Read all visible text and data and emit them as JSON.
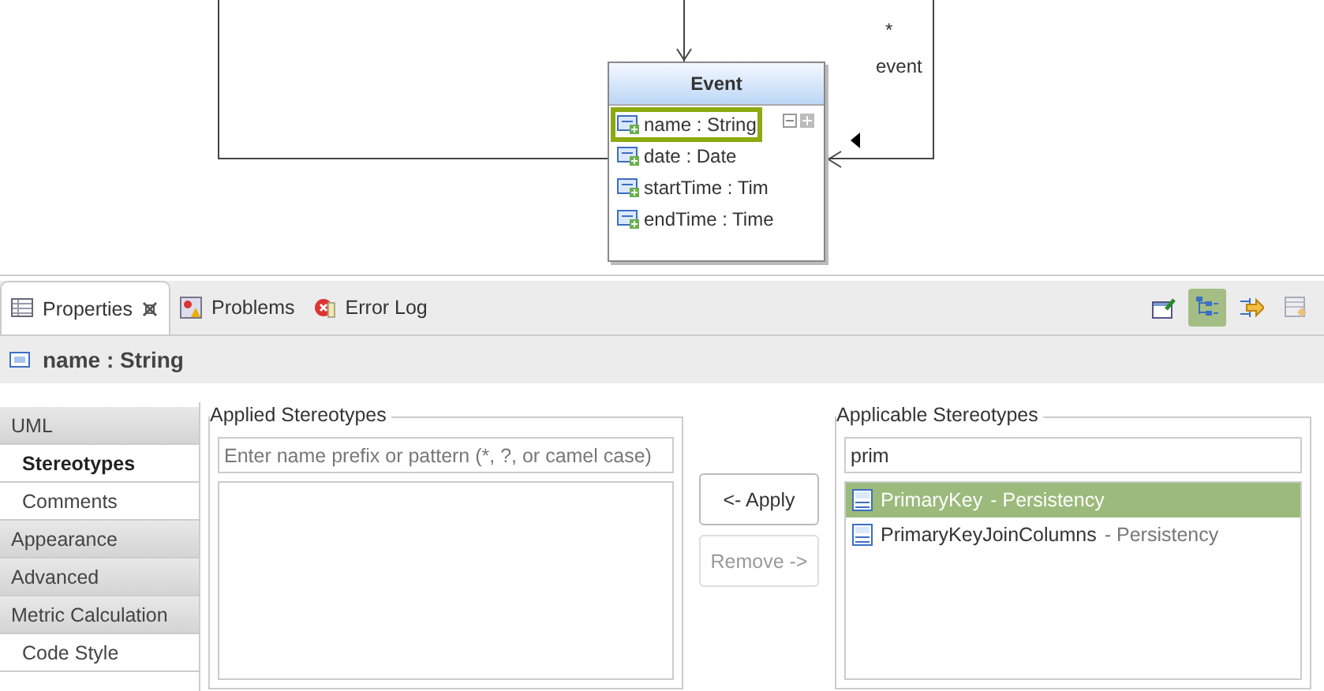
{
  "diagram": {
    "class": {
      "name": "Event",
      "attributes": [
        {
          "label": "name : String",
          "selected": true
        },
        {
          "label": "date : Date",
          "selected": false
        },
        {
          "label": "startTime : Tim",
          "selected": false
        },
        {
          "label": "endTime : Time",
          "selected": false
        }
      ]
    },
    "association": {
      "multiplicity": "*",
      "role": "event"
    }
  },
  "tabs": [
    {
      "label": "Properties",
      "closable": true,
      "selected": true
    },
    {
      "label": "Problems",
      "closable": false,
      "selected": false
    },
    {
      "label": "Error Log",
      "closable": false,
      "selected": false
    }
  ],
  "toolbar": [
    {
      "selected": false
    },
    {
      "selected": true
    },
    {
      "selected": false
    },
    {
      "selected": false
    }
  ],
  "title": "name : String",
  "sidebar": {
    "items": [
      {
        "label": "UML",
        "kind": "section",
        "selected": false
      },
      {
        "label": "Stereotypes",
        "kind": "sub",
        "selected": true
      },
      {
        "label": "Comments",
        "kind": "sub",
        "selected": false
      },
      {
        "label": "Appearance",
        "kind": "section",
        "selected": false
      },
      {
        "label": "Advanced",
        "kind": "section",
        "selected": false
      },
      {
        "label": "Metric Calculation",
        "kind": "section",
        "selected": false
      },
      {
        "label": "Code Style",
        "kind": "sub",
        "selected": false
      }
    ]
  },
  "applied": {
    "label": "Applied Stereotypes",
    "placeholder": "Enter name prefix or pattern (*, ?, or camel case)"
  },
  "buttons": [
    {
      "label": "<- Apply",
      "disabled": false
    },
    {
      "label": "Remove ->",
      "disabled": true
    }
  ],
  "applicable": {
    "label": "Applicable Stereotypes",
    "value": "prim",
    "items": [
      {
        "name": "PrimaryKey",
        "profile": "- Persistency",
        "selected": true
      },
      {
        "name": "PrimaryKeyJoinColumns",
        "profile": "- Persistency",
        "selected": false
      }
    ]
  }
}
